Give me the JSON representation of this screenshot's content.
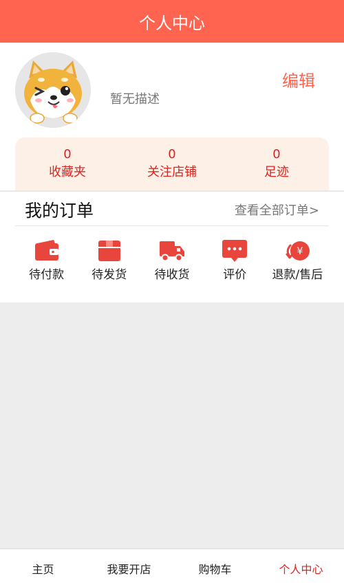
{
  "header": {
    "title": "个人中心"
  },
  "profile": {
    "description": "暂无描述",
    "edit_label": "编辑"
  },
  "stats": [
    {
      "count": "0",
      "label": "收藏夹"
    },
    {
      "count": "0",
      "label": "关注店铺"
    },
    {
      "count": "0",
      "label": "足迹"
    }
  ],
  "orders": {
    "title": "我的订单",
    "view_all": "查看全部订单>",
    "items": [
      {
        "label": "待付款",
        "icon": "wallet-icon"
      },
      {
        "label": "待发货",
        "icon": "package-icon"
      },
      {
        "label": "待收货",
        "icon": "truck-icon"
      },
      {
        "label": "评价",
        "icon": "comment-icon"
      },
      {
        "label": "退款/售后",
        "icon": "refund-icon"
      }
    ]
  },
  "tabbar": {
    "items": [
      {
        "label": "主页"
      },
      {
        "label": "我要开店"
      },
      {
        "label": "购物车"
      },
      {
        "label": "个人中心"
      }
    ],
    "active_index": 3
  },
  "colors": {
    "brand": "#ff6450",
    "accent_red": "#e0221f",
    "icon_red": "#e8453c",
    "stats_bg": "#fdf0e6",
    "page_bg": "#ededed"
  }
}
